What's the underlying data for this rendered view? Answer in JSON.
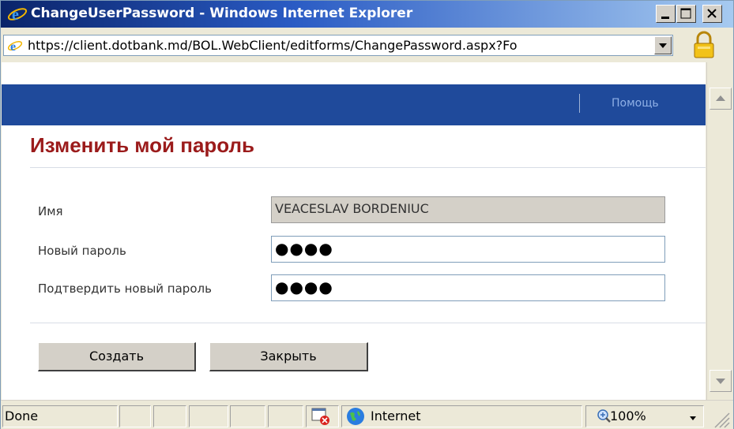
{
  "window": {
    "title": "ChangeUserPassword - Windows Internet Explorer"
  },
  "address": {
    "url": "https://client.dotbank.md/BOL.WebClient/editforms/ChangePassword.aspx?Fo"
  },
  "page": {
    "help_link": "Помощь",
    "title": "Изменить мой пароль"
  },
  "form": {
    "name_label": "Имя",
    "name_value": "VEACESLAV BORDENIUC",
    "new_password_label": "Новый пароль",
    "new_password_value": "●●●●",
    "confirm_password_label": "Подтвердить новый пароль",
    "confirm_password_value": "●●●●"
  },
  "buttons": {
    "create_label": "Создать",
    "close_label": "Закрыть"
  },
  "status": {
    "text": "Done",
    "zone": "Internet",
    "zoom": "100%"
  },
  "icons": {
    "browser": "ie-icon",
    "lock": "lock-icon",
    "globe": "globe-icon",
    "popup_blocked": "popup-blocked-icon",
    "zoom": "zoom-icon"
  },
  "colors": {
    "title_red": "#9b1b1b",
    "band_blue": "#1f4a9b"
  }
}
